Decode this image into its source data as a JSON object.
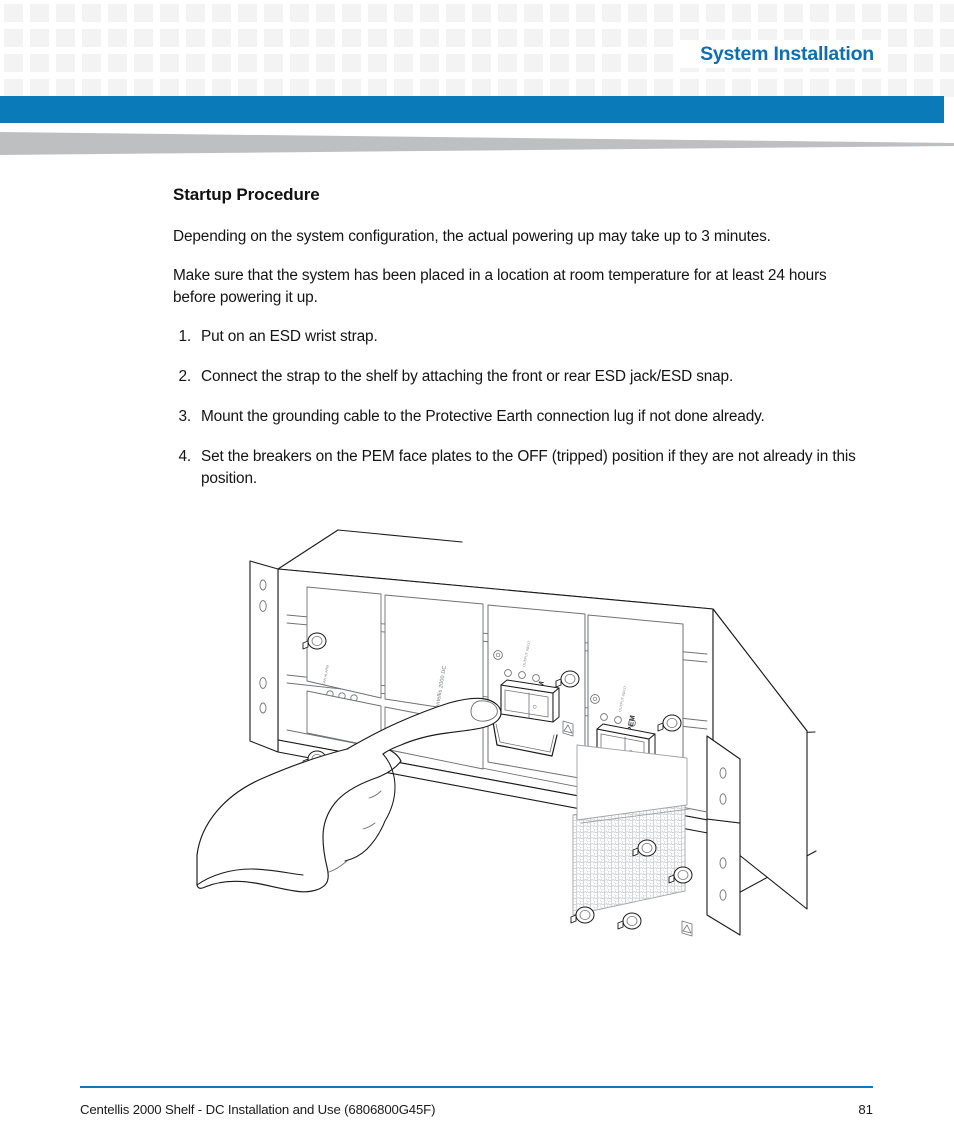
{
  "header": {
    "title": "System Installation",
    "accent_color": "#0b7ab8",
    "title_color": "#0d6fb0",
    "pattern_color": "#f3f3f3",
    "wedge_color": "#bdbfc1"
  },
  "content": {
    "section_title": "Startup Procedure",
    "paragraphs": [
      "Depending on the system configuration, the actual powering up may take up to 3 minutes.",
      "Make sure that the system has been placed in a location at room temperature for at least 24 hours before powering it up."
    ],
    "steps": [
      {
        "number": "1.",
        "text": "Put on an ESD wrist strap."
      },
      {
        "number": "2.",
        "text": "Connect the strap to the shelf by attaching the front or rear ESD jack/ESD snap."
      },
      {
        "number": "3.",
        "text": "Mount the grounding cable to the Protective Earth connection lug if not done already."
      },
      {
        "number": "4.",
        "text": "Set the breakers on the PEM face plates to the OFF (tripped) position if they are not already in this position."
      }
    ]
  },
  "figure": {
    "caption": "",
    "alt": "Line drawing of a rack-mounted Centellis 2000 DC shelf shown in three-quarter perspective with a hand pressing the circuit breaker on the left PEM face plate",
    "labels": {
      "pem_left": "PEM",
      "pem_right": "PEM",
      "product_label": "Centellis 2000 DC"
    },
    "line_color": "#1a1a1a",
    "detail_color": "#6f7275",
    "mesh_color": "#c9cbcd"
  },
  "footer": {
    "document_title": "Centellis 2000 Shelf - DC Installation and Use (6806800G45F)",
    "page_number": "81",
    "rule_color": "#0b7ab8"
  }
}
